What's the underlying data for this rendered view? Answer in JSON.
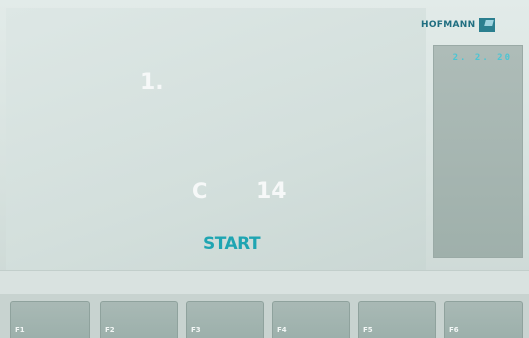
{
  "brand": {
    "name": "HOFMANN",
    "icon": "hofmann-logo-icon"
  },
  "side_panel": {
    "value": "2. 2. 20"
  },
  "main": {
    "step": "1.",
    "code_label": "C",
    "code_value": "14",
    "start": "START"
  },
  "function_keys": [
    {
      "label": "F1"
    },
    {
      "label": "F2"
    },
    {
      "label": "F3"
    },
    {
      "label": "F4"
    },
    {
      "label": "F5"
    },
    {
      "label": "F6"
    }
  ],
  "colors": {
    "accent": "#1fa5b2",
    "brand": "#1f6e80",
    "side_text": "#4cc5d3",
    "text": "#f6f8f8"
  }
}
